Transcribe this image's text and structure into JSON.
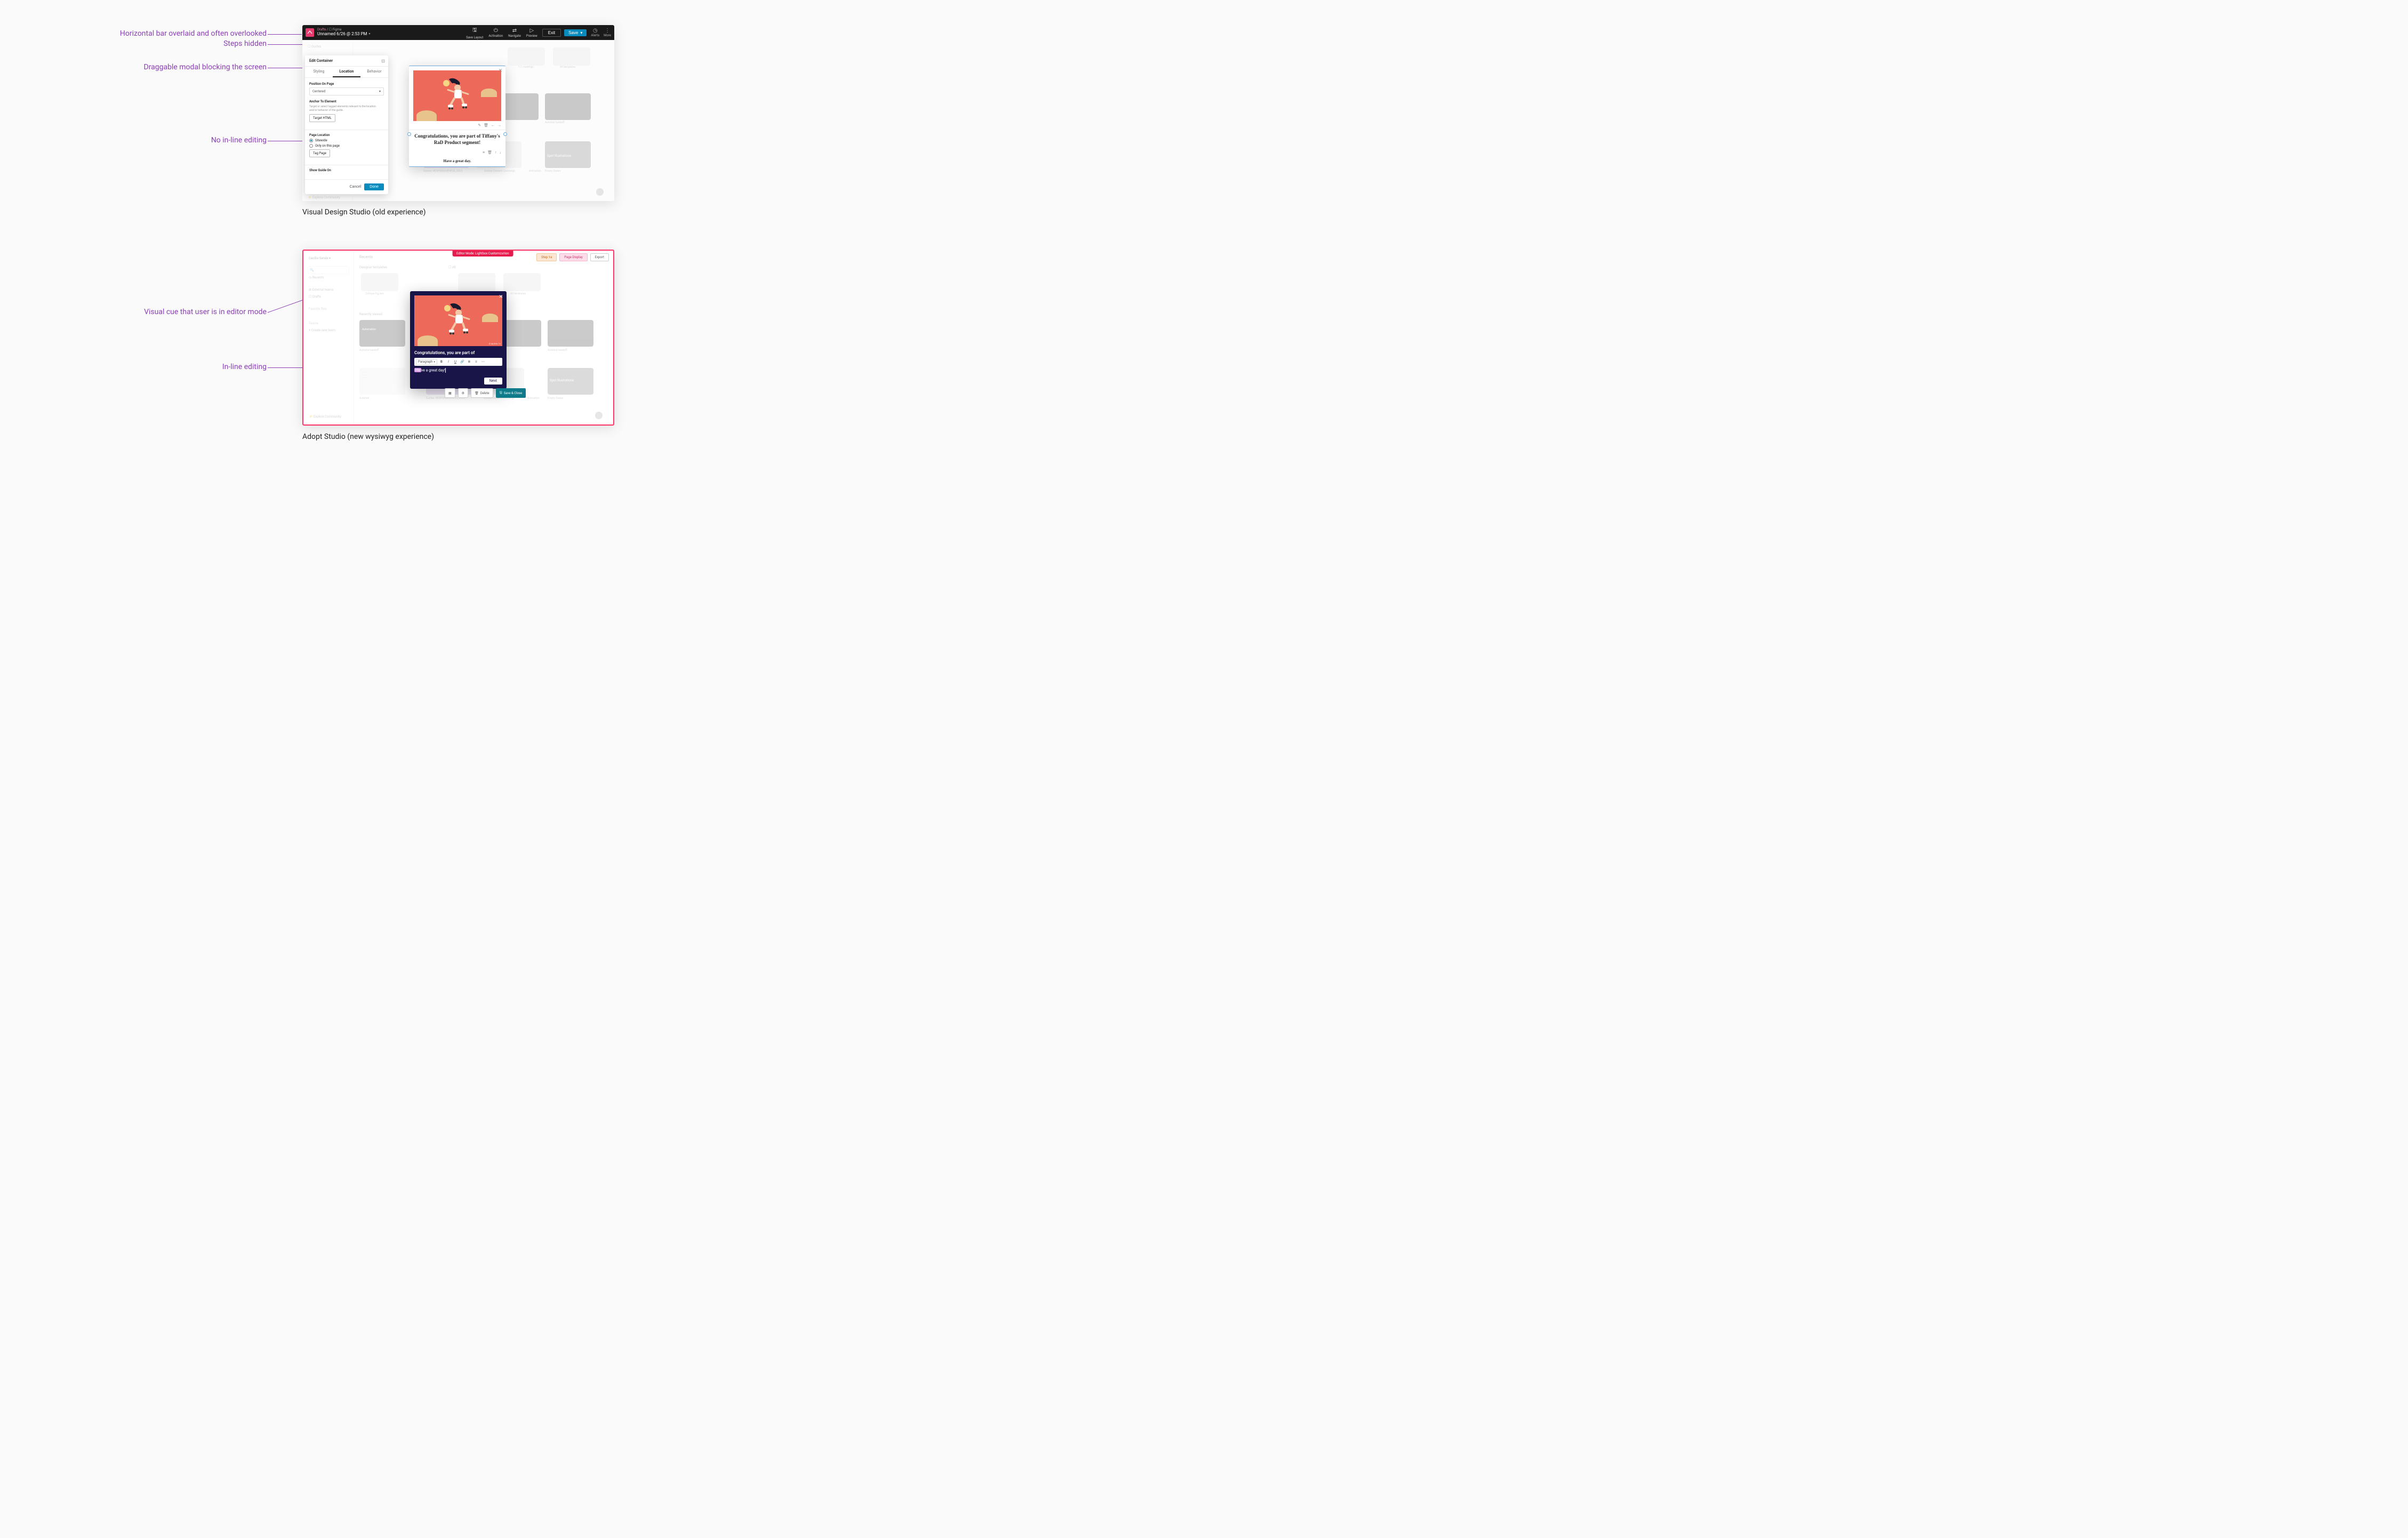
{
  "annotations": {
    "a1": "Horizontal bar overlaid and often overlooked",
    "a2": "Steps hidden",
    "a3": "Draggable modal blocking the screen",
    "a4": "No in-line editing",
    "a5": "Visual cue that user is in editor mode",
    "a6": "In-line editing"
  },
  "captions": {
    "old": "Visual Design Studio (old experience)",
    "new": "Adopt Studio (new wysiwyg experience)"
  },
  "toolbar": {
    "crumb_parent": "Drafts",
    "crumb_leaf": "Figma",
    "doc_title": "Unnamed 6/26 @ 2:53 PM",
    "save_layout": "Save Layout",
    "activation": "Activation",
    "navigate": "Navigate",
    "preview": "Preview",
    "exit": "Exit",
    "save": "Save",
    "alerts": "Alerts",
    "more": "More",
    "view_steps": "View Steps"
  },
  "edit_panel": {
    "title": "Edit Container",
    "tabs": {
      "styling": "Styling",
      "location": "Location",
      "behavior": "Behavior"
    },
    "position_label": "Position On Page",
    "position_value": "Centered",
    "anchor_label": "Anchor To Element",
    "anchor_help": "Target or select tagged elements relevant to the location and/or behavior of the guide.",
    "target_html": "Target HTML",
    "page_loc_label": "Page Location",
    "page_loc_opts": {
      "sitewide": "Sitewide",
      "only": "Only on this page"
    },
    "tag_page": "Tag Page",
    "show_guide_label": "Show Guide On",
    "cancel": "Cancel",
    "done": "Done"
  },
  "guide_modal": {
    "headline": "Congratulations, you are part of Tiffany's RaD Product segment!",
    "sub": "Have a great day."
  },
  "new_ui": {
    "badge": "Editor Mode: Lightbox Customization",
    "chips": {
      "style": "Step 1a",
      "target": "Page Display",
      "export": "Export"
    },
    "sidebar": {
      "user": "Cecilia Serale",
      "recents": "Recents",
      "external": "External teams",
      "drafts": "Drafts",
      "fav": "Favorite files",
      "teams": "Teams",
      "create": "Create new team",
      "explore": "Explore Community"
    },
    "hero_credit": "© MUFIN TV"
  },
  "adopt_modal": {
    "headline": "Congratulations, you are part of",
    "rte": {
      "paragraph": "Paragraph"
    },
    "body_text": "Have a great day!",
    "next": "Next"
  },
  "adopt_actions": {
    "delete": "Delete",
    "save_close": "Save & Close"
  },
  "bg_tiles": {
    "templates": "All templates",
    "meetings": "1:1 meetings",
    "spot": "Spot Illustrations",
    "responsiveness": "RESPONSIVENESS",
    "guides_resp": "Guides: RESPONSIVENESS_2023",
    "concierge": "Guides Content Concierge",
    "animation": "Animation",
    "empty": "Empty States",
    "autolink": "Autolink",
    "autolink_handoff": "Autolink handoff",
    "figwatch": "figwatch",
    "recently": "Recently viewed",
    "recents_tab": "Recents",
    "designer": "Designer templates",
    "all": "All",
    "critique": "Critique FigJam",
    "automation": "Automation"
  }
}
